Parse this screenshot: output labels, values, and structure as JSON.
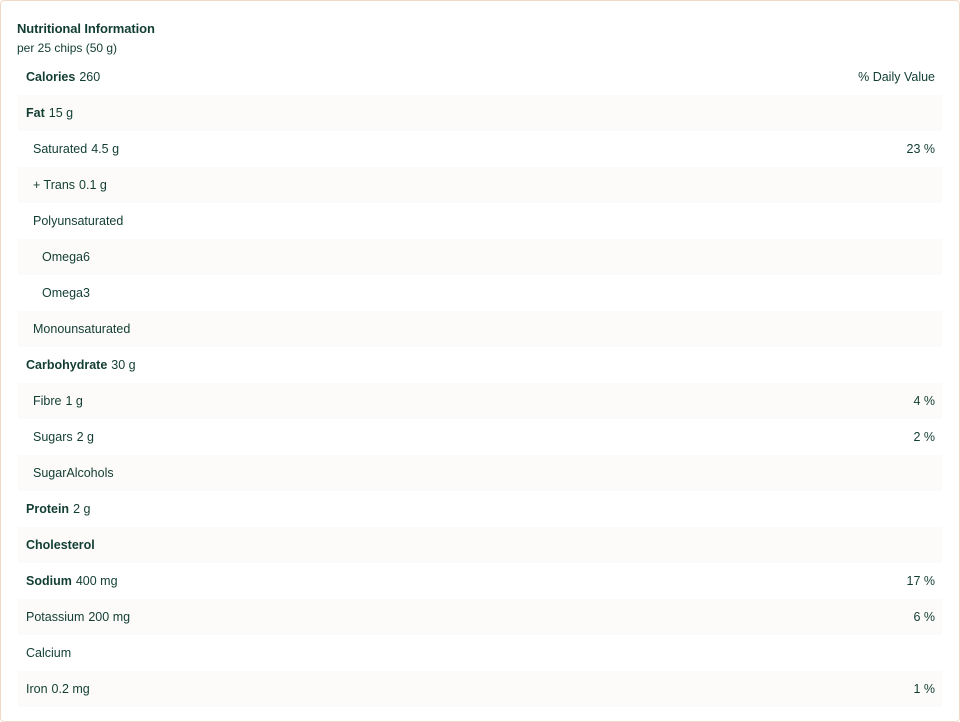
{
  "panel": {
    "title": "Nutritional Information",
    "serving": "per 25 chips (50 g)"
  },
  "rows": [
    {
      "name": "Calories",
      "amount": "260",
      "dv": "% Daily Value",
      "bold": true,
      "level": 0
    },
    {
      "name": "Fat",
      "amount": "15 g",
      "dv": "",
      "bold": true,
      "level": 0
    },
    {
      "name": "Saturated",
      "amount": "4.5 g",
      "dv": "23 %",
      "bold": false,
      "level": 1
    },
    {
      "name": "+ Trans",
      "amount": "0.1 g",
      "dv": "",
      "bold": false,
      "level": 1
    },
    {
      "name": "Polyunsaturated",
      "amount": "",
      "dv": "",
      "bold": false,
      "level": 1
    },
    {
      "name": "Omega6",
      "amount": "",
      "dv": "",
      "bold": false,
      "level": 2
    },
    {
      "name": "Omega3",
      "amount": "",
      "dv": "",
      "bold": false,
      "level": 2
    },
    {
      "name": "Monounsaturated",
      "amount": "",
      "dv": "",
      "bold": false,
      "level": 1
    },
    {
      "name": "Carbohydrate",
      "amount": "30 g",
      "dv": "",
      "bold": true,
      "level": 0
    },
    {
      "name": "Fibre",
      "amount": "1 g",
      "dv": "4 %",
      "bold": false,
      "level": 1
    },
    {
      "name": "Sugars",
      "amount": "2 g",
      "dv": "2 %",
      "bold": false,
      "level": 1
    },
    {
      "name": "SugarAlcohols",
      "amount": "",
      "dv": "",
      "bold": false,
      "level": 1
    },
    {
      "name": "Protein",
      "amount": "2 g",
      "dv": "",
      "bold": true,
      "level": 0
    },
    {
      "name": "Cholesterol",
      "amount": "",
      "dv": "",
      "bold": true,
      "level": 0
    },
    {
      "name": "Sodium",
      "amount": "400 mg",
      "dv": "17 %",
      "bold": true,
      "level": 0
    },
    {
      "name": "Potassium",
      "amount": "200 mg",
      "dv": "6 %",
      "bold": false,
      "level": 0
    },
    {
      "name": "Calcium",
      "amount": "",
      "dv": "",
      "bold": false,
      "level": 0
    },
    {
      "name": "Iron",
      "amount": "0.2 mg",
      "dv": "1 %",
      "bold": false,
      "level": 0
    }
  ],
  "colors": {
    "text": "#123d33",
    "border": "#f0d9c7",
    "row_alt": "#fcfbf9"
  }
}
